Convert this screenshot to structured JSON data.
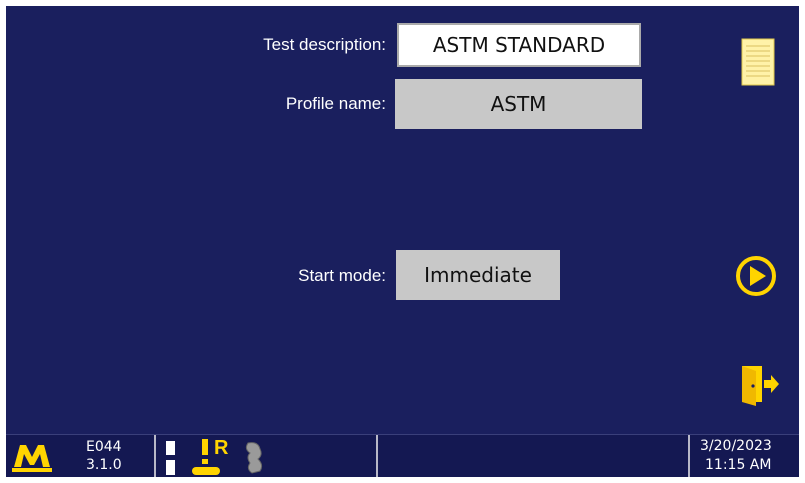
{
  "form": {
    "test_description_label": "Test description:",
    "test_description_value": "ASTM STANDARD",
    "profile_name_label": "Profile name:",
    "profile_name_value": "ASTM",
    "start_mode_label": "Start mode:",
    "start_mode_value": "Immediate"
  },
  "side_buttons": {
    "notes": "document-icon",
    "start": "play-icon",
    "exit": "exit-door-icon"
  },
  "status_bar": {
    "logo": "M",
    "code": "E044",
    "version": "3.1.0",
    "status_icons": [
      "load-cell-icon",
      "warning-icon",
      "remote-icon",
      "handset-icon"
    ],
    "remote_letter": "R",
    "date": "3/20/2023",
    "time": "11:15 AM"
  },
  "colors": {
    "background": "#1a1f5e",
    "accent_yellow": "#ffd400",
    "field_gray": "#c8c8c8"
  }
}
